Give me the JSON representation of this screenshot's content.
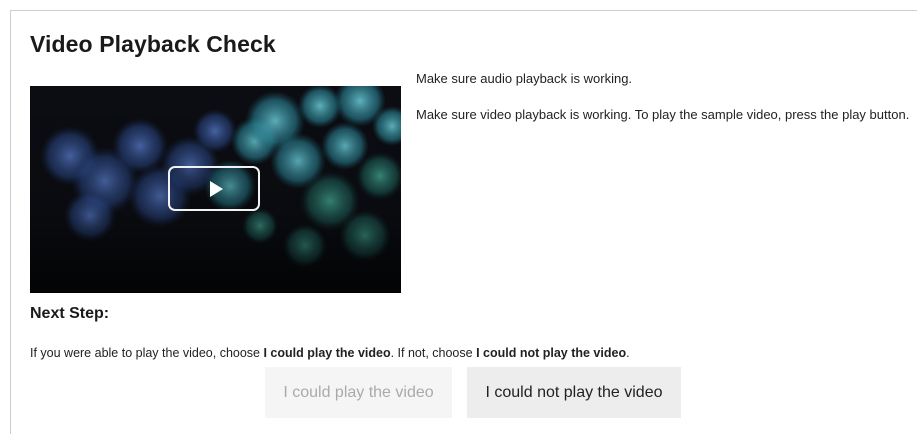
{
  "page": {
    "title": "Video Playback Check",
    "audio_message": "Make sure audio playback is working.",
    "video_message": "Make sure video playback is working. To play the sample video, press the play button."
  },
  "video": {
    "play_icon": "play-icon"
  },
  "next_step": {
    "heading": "Next Step:",
    "instruction_prefix": "If you were able to play the video, choose ",
    "instruction_option_yes": "I could play the video",
    "instruction_middle": ". If not, choose ",
    "instruction_option_no": "I could not play the video",
    "instruction_suffix": "."
  },
  "buttons": {
    "could_play": "I could play the video",
    "could_not_play": "I could not play the video"
  },
  "colors": {
    "disabled_button_bg": "#f5f5f5",
    "disabled_button_text": "#aaaaaa",
    "button_bg": "#ededed",
    "video_bg": "#0b0d12",
    "bokeh_teal": "#3fa6b8",
    "bokeh_blue": "#3c5fa8"
  }
}
